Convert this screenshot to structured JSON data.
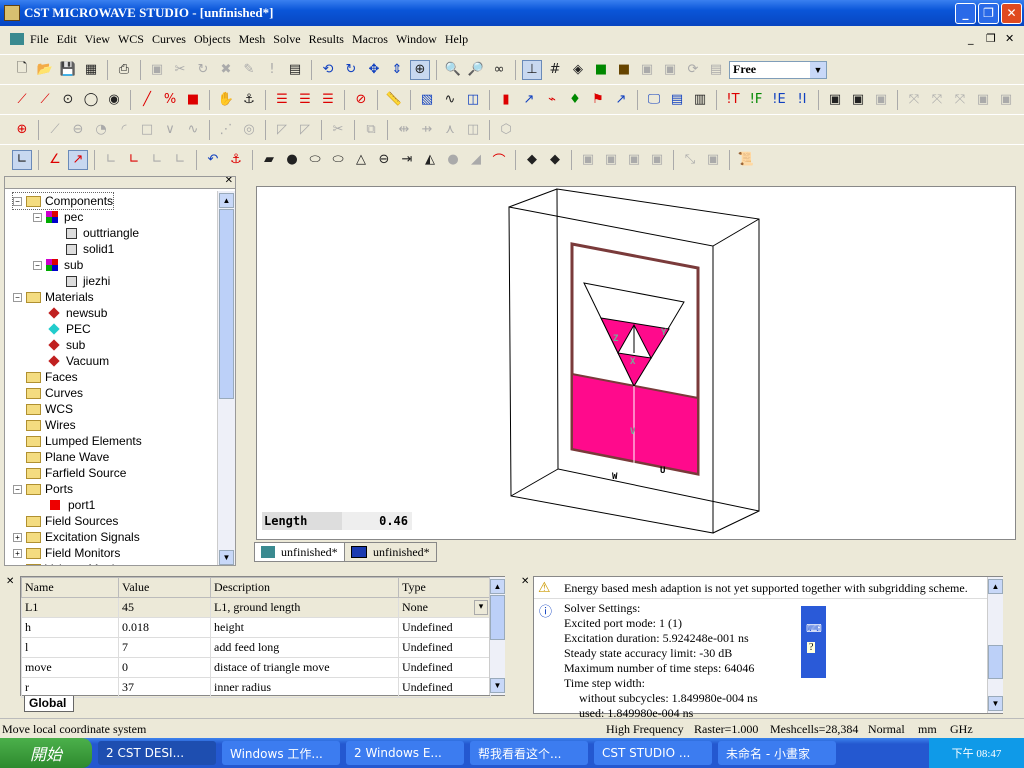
{
  "window": {
    "title": "CST MICROWAVE STUDIO - [unfinished*]",
    "min": "_",
    "max": "❐",
    "close": "✕"
  },
  "menu": [
    "File",
    "Edit",
    "View",
    "WCS",
    "Curves",
    "Objects",
    "Mesh",
    "Solve",
    "Results",
    "Macros",
    "Window",
    "Help"
  ],
  "toolbar": {
    "mode_select": "Free"
  },
  "tree": [
    {
      "label": "Components",
      "level": 0,
      "icon": "folder",
      "exp": "-"
    },
    {
      "label": "pec",
      "level": 1,
      "icon": "component",
      "exp": "-"
    },
    {
      "label": "outtriangle",
      "level": 2,
      "icon": "solid"
    },
    {
      "label": "solid1",
      "level": 2,
      "icon": "solid"
    },
    {
      "label": "sub",
      "level": 1,
      "icon": "component",
      "exp": "-"
    },
    {
      "label": "jiezhi",
      "level": 2,
      "icon": "solid"
    },
    {
      "label": "Materials",
      "level": 0,
      "icon": "folder",
      "exp": "-"
    },
    {
      "label": "newsub",
      "level": 1,
      "icon": "material-red"
    },
    {
      "label": "PEC",
      "level": 1,
      "icon": "material-cyan"
    },
    {
      "label": "sub",
      "level": 1,
      "icon": "material-red"
    },
    {
      "label": "Vacuum",
      "level": 1,
      "icon": "material-red"
    },
    {
      "label": "Faces",
      "level": 0,
      "icon": "folder"
    },
    {
      "label": "Curves",
      "level": 0,
      "icon": "folder"
    },
    {
      "label": "WCS",
      "level": 0,
      "icon": "folder"
    },
    {
      "label": "Wires",
      "level": 0,
      "icon": "folder"
    },
    {
      "label": "Lumped Elements",
      "level": 0,
      "icon": "folder"
    },
    {
      "label": "Plane Wave",
      "level": 0,
      "icon": "folder"
    },
    {
      "label": "Farfield Source",
      "level": 0,
      "icon": "folder"
    },
    {
      "label": "Ports",
      "level": 0,
      "icon": "folder",
      "exp": "-"
    },
    {
      "label": "port1",
      "level": 1,
      "icon": "port"
    },
    {
      "label": "Field Sources",
      "level": 0,
      "icon": "folder"
    },
    {
      "label": "Excitation Signals",
      "level": 0,
      "icon": "folder",
      "exp": "+"
    },
    {
      "label": "Field Monitors",
      "level": 0,
      "icon": "folder",
      "exp": "+"
    },
    {
      "label": "Voltage Monitors",
      "level": 0,
      "icon": "folder"
    }
  ],
  "viewport": {
    "measure_label": "Length",
    "measure_value": "0.46",
    "axes": [
      "Z",
      "Y",
      "X",
      "V",
      "W",
      "U"
    ],
    "colors": {
      "pec": "#ff0a8c",
      "substrate_border": "#7a3a3a"
    }
  },
  "doc_tabs": [
    "unfinished*",
    "unfinished*"
  ],
  "params": {
    "headers": [
      "Name",
      "Value",
      "Description",
      "Type"
    ],
    "rows": [
      [
        "L1",
        "45",
        "L1, ground length",
        "None"
      ],
      [
        "h",
        "0.018",
        "height",
        "Undefined"
      ],
      [
        "l",
        "7",
        "add feed long",
        "Undefined"
      ],
      [
        "move",
        "0",
        "distace of triangle move",
        "Undefined"
      ],
      [
        "r",
        "37",
        "inner radius",
        "Undefined"
      ]
    ],
    "tab": "Global"
  },
  "messages": {
    "warning": "Energy based mesh adaption is not yet supported together with subgridding scheme.",
    "info": [
      "Solver Settings:",
      "Excited port mode: 1 (1)",
      "Excitation duration: 5.924248e-001 ns",
      "Steady state accuracy limit: -30 dB",
      "Maximum number of time steps: 64046",
      "Time step width:",
      "without subcycles: 1.849980e-004 ns",
      "used: 1.849980e-004 ns"
    ]
  },
  "status": {
    "text": "Move local coordinate system",
    "mode": "High Frequency",
    "raster": "Raster=1.000",
    "meshcells": "Meshcells=28,384",
    "view": "Normal",
    "unit": "mm",
    "freq": "GHz"
  },
  "taskbar": {
    "start": "開始",
    "tasks": [
      "2 CST DESI...",
      "Windows 工作...",
      "2 Windows E...",
      "帮我看看这个...",
      "CST STUDIO ...",
      "未命名 - 小畫家"
    ],
    "clock": "下午 08:47"
  }
}
